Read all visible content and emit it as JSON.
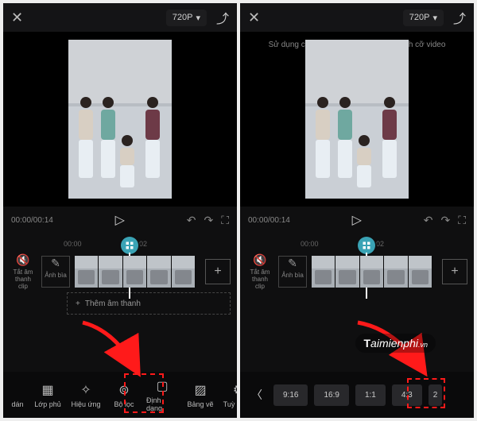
{
  "both": {
    "resolution": "720P",
    "time": "00:00/00:14",
    "ruler": [
      "00:00",
      "00:02"
    ],
    "mute_label": "Tắt âm thanh clip",
    "cover_label": "Ảnh bìa",
    "audio_label": "Thêm âm thanh",
    "watermark_main": "aimienphi",
    "watermark_prefix": "T",
    "watermark_suffix": ".vn"
  },
  "screen1": {
    "toolbar": [
      {
        "icon": "▦",
        "label": "Lớp phủ"
      },
      {
        "icon": "✧",
        "label": "Hiệu ứng"
      },
      {
        "icon": "⊚",
        "label": "Bộ lọc"
      },
      {
        "icon": "▢",
        "label": "Định dạng"
      },
      {
        "icon": "▨",
        "label": "Bảng vẽ"
      },
      {
        "icon": "⚙",
        "label": "Tuỳ chỉnh"
      }
    ],
    "partial_left": "dán"
  },
  "screen2": {
    "hint": "Sử dụng cả hai ngón tay để thay đổi kích cỡ video",
    "ratios": [
      "9:16",
      "16:9",
      "1:1",
      "4:3",
      "2"
    ]
  }
}
